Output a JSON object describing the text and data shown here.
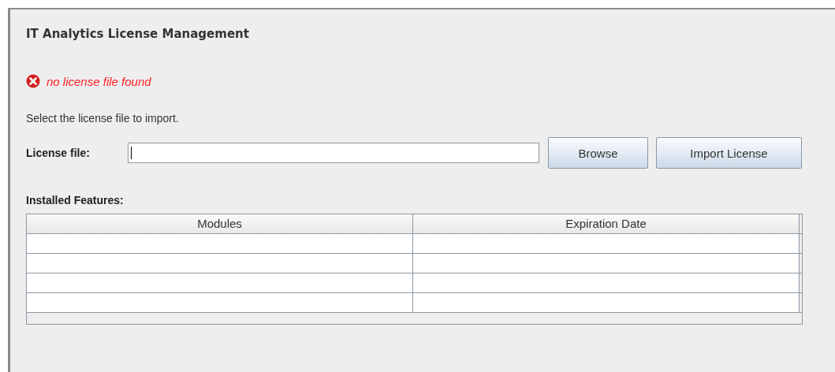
{
  "title": "IT Analytics License Management",
  "error": {
    "message": "no license file found"
  },
  "instruction": "Select the license file to import.",
  "license_field": {
    "label": "License file:",
    "focused": true
  },
  "buttons": [
    "Browse",
    "Import License"
  ],
  "features": {
    "label": "Installed Features:",
    "columns": [
      "Modules",
      "Expiration Date"
    ]
  }
}
